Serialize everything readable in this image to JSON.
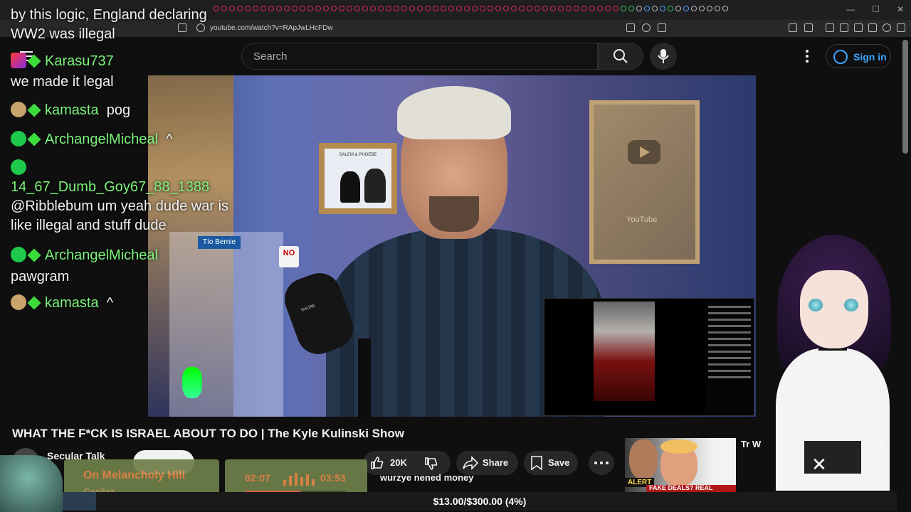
{
  "browser": {
    "url": "youtube.com/watch?v=RApJwLHcFDw"
  },
  "header": {
    "search_placeholder": "Search",
    "signin_label": "Sign in"
  },
  "chat": {
    "messages": [
      {
        "user": "",
        "text": "by this logic, England declaring WW2 was illegal"
      },
      {
        "user": "Karasu737",
        "text": ""
      },
      {
        "user": "",
        "text": "we made it legal"
      },
      {
        "user": "kamasta",
        "text": "pog"
      },
      {
        "user": "ArchangelMicheal",
        "text": "^"
      },
      {
        "user": "14_67_Dumb_Goy67_88_1388",
        "text": "@Ribblebum um yeah dude war is like illegal and stuff dude"
      },
      {
        "user": "ArchangelMicheal",
        "text": "pawgram"
      },
      {
        "user": "kamasta",
        "text": "^"
      }
    ]
  },
  "video": {
    "title": "WHAT THE F*CK IS ISRAEL ABOUT TO DO | The Kyle Kulinski Show",
    "channel": "Secular Talk",
    "likes": "20K",
    "share_label": "Share",
    "save_label": "Save",
    "frame_caption": "SALEM & PHOEBE",
    "plaque_label": "YouTube",
    "sign_text": "NO",
    "book_text": "Tío Bernie",
    "mic_text": "SHURE"
  },
  "music": {
    "title": "On Melancholy Hill",
    "artist": "Gorillaz",
    "elapsed": "02:07",
    "total": "03:53",
    "progress": 0.55
  },
  "bottom_chat": {
    "text": "wurzye nened money"
  },
  "goal": {
    "text": "$13.00/$300.00 (4%)",
    "fraction": 0.04
  },
  "recommended": {
    "alert": "ALERT",
    "strip_text": "FAKE DEALS? REAL MELTD",
    "text": "Tr W"
  },
  "colors": {
    "accent_link": "#3ea6ff",
    "chat_username": "#7cf37c",
    "music_text": "#e98a4a"
  }
}
